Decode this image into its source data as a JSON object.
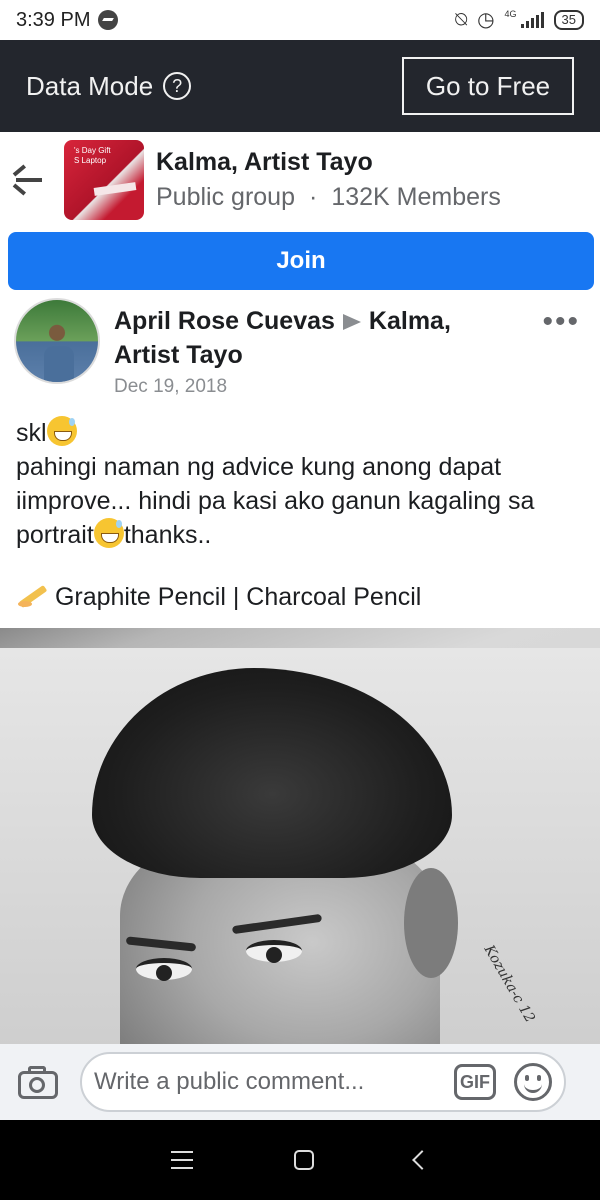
{
  "status_bar": {
    "time": "3:39 PM",
    "network": "4G",
    "battery": "35"
  },
  "data_banner": {
    "title": "Data Mode",
    "help_symbol": "?",
    "go_free_label": "Go to Free"
  },
  "group": {
    "name": "Kalma, Artist Tayo",
    "type": "Public group",
    "members": "132K Members",
    "thumb_text": "'s Day Gift\nS Laptop",
    "separator": "·"
  },
  "join_label": "Join",
  "post": {
    "author": "April Rose Cuevas",
    "target_group": "Kalma,",
    "target_group_cont": "Artist Tayo",
    "date": "Dec 19, 2018",
    "more_label": "•••",
    "line1": "skl",
    "line2": "pahingi naman ng advice kung anong dapat iimprove... hindi pa kasi ako ganun kagaling sa portrait",
    "line2_end": "thanks..",
    "tools": "Graphite Pencil | Charcoal Pencil",
    "signature": "Kozuka-c 12"
  },
  "comment_bar": {
    "placeholder": "Write a public comment...",
    "gif_label": "GIF"
  },
  "icons": {
    "camera": "camera-icon",
    "gif": "gif-icon",
    "smile": "emoji-icon",
    "back": "back-arrow-icon",
    "more": "more-icon"
  },
  "colors": {
    "accent": "#1877f2",
    "banner_bg": "#23262d",
    "nav_bg": "#000000"
  }
}
